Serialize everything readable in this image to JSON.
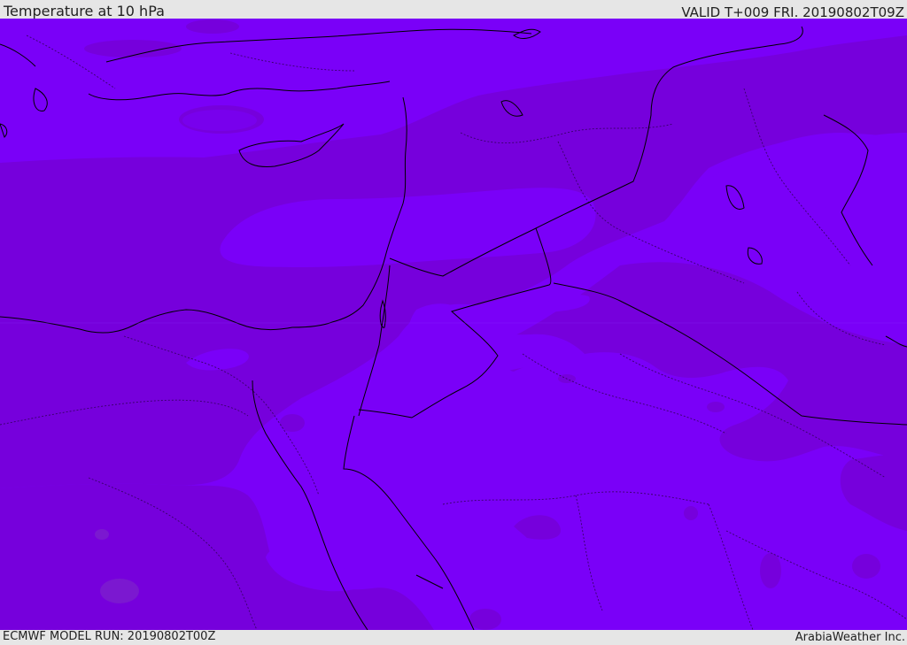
{
  "header": {
    "title": "Temperature at 10 hPa",
    "valid_time": "VALID T+009 FRI. 20190802T09Z"
  },
  "footer": {
    "model_run": "ECMWF MODEL RUN: 20190802T00Z",
    "credit": "ArabiaWeather Inc."
  },
  "map": {
    "region": "Eastern Mediterranean and Middle East",
    "field": "temperature",
    "colors": {
      "light_band": "#7a00f8",
      "dark_band": "#7600dc",
      "spot": "#7b18d0",
      "coastline": "#000000"
    }
  }
}
